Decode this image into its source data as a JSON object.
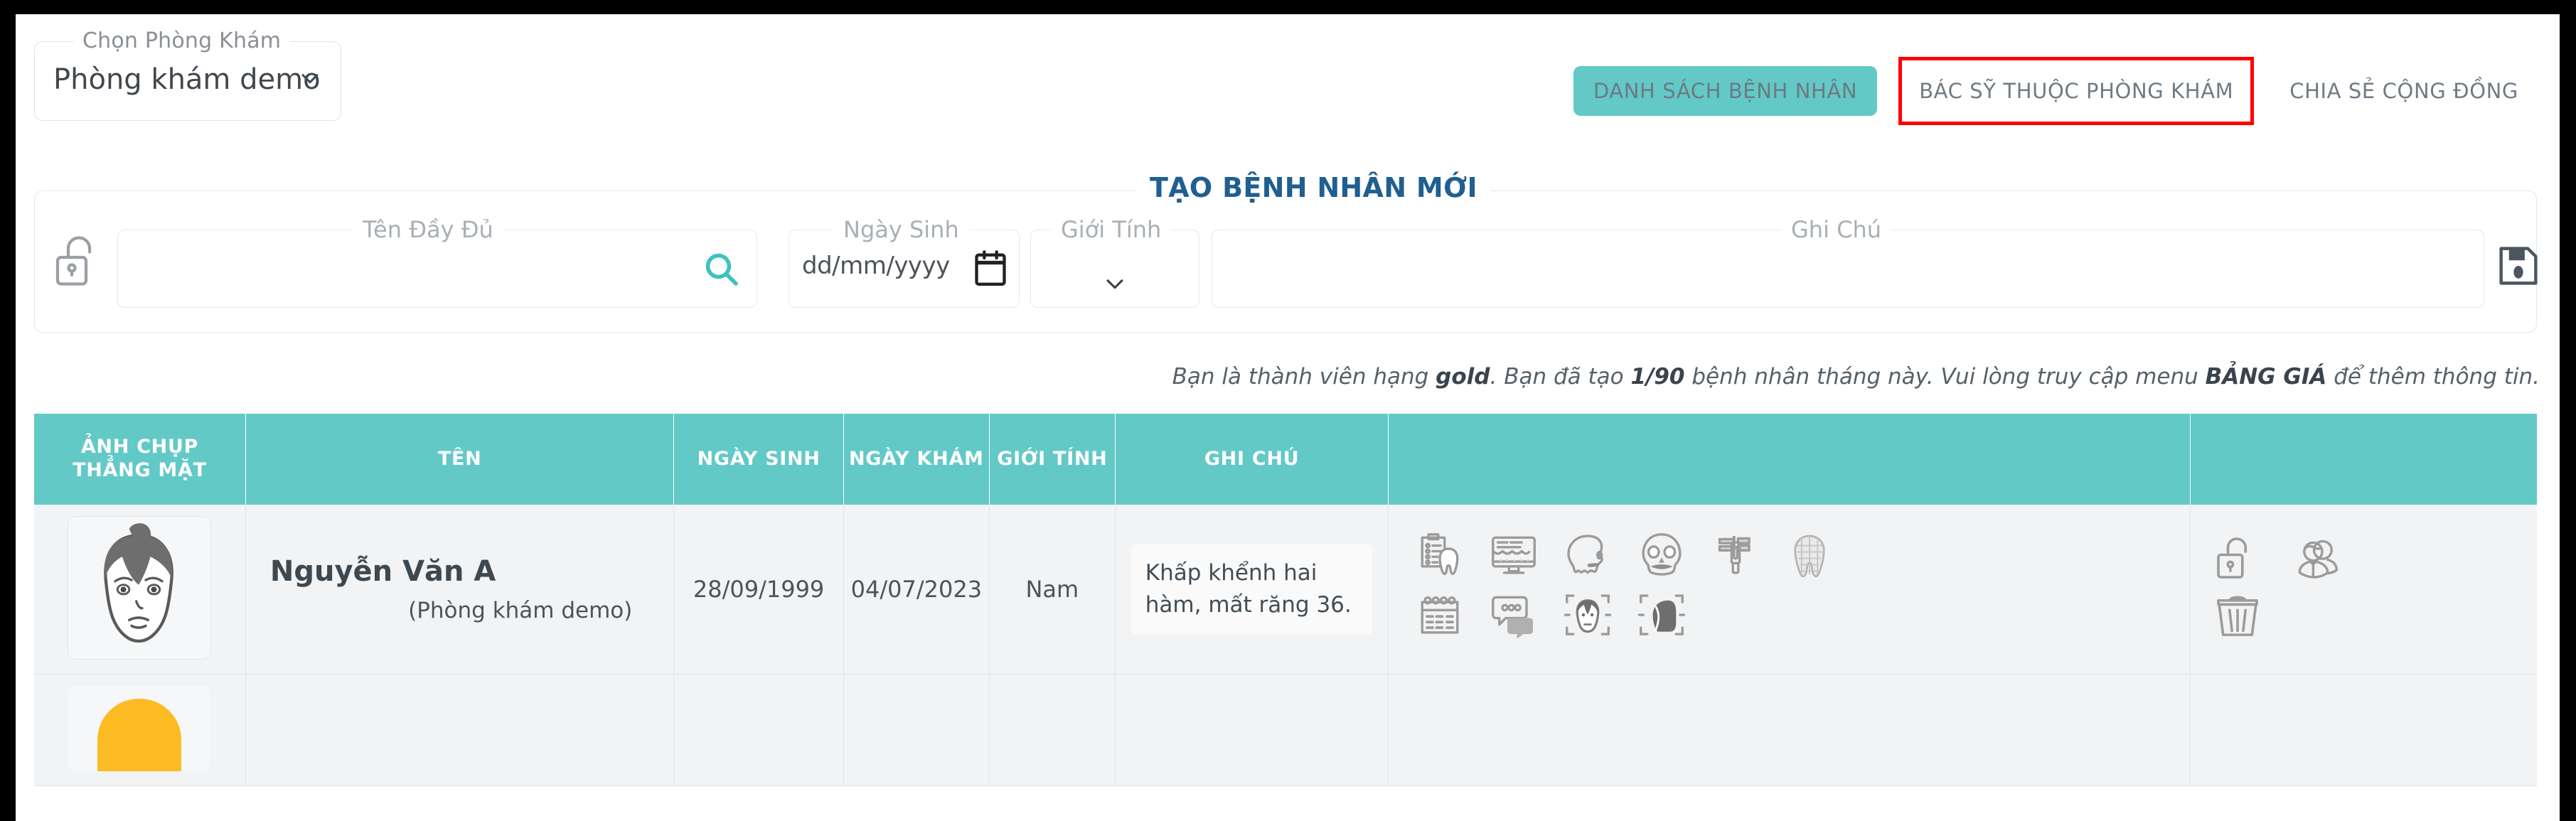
{
  "clinic_selector": {
    "legend": "Chọn Phòng Khám",
    "value": "Phòng khám demo",
    "chevron_icon": "chevron-down-icon"
  },
  "nav": {
    "patient_list": "DANH SÁCH BỆNH NHÂN",
    "clinic_doctors": "BÁC SỸ THUỘC PHÒNG KHÁM",
    "community_share": "CHIA SẺ CỘNG ĐỒNG",
    "highlight_color": "#ff0000",
    "accent_color": "#62c9c7"
  },
  "create_patient": {
    "title": "TẠO BỆNH NHÂN MỚI",
    "lock_icon": "unlock-icon",
    "fields": {
      "full_name": {
        "label": "Tên Đầy Đủ",
        "value": "",
        "placeholder": "",
        "icon": "search-icon"
      },
      "dob": {
        "label": "Ngày Sinh",
        "value": "",
        "placeholder": "dd/mm/yyyy",
        "icon": "calendar-icon"
      },
      "gender": {
        "label": "Giới Tính",
        "value": "",
        "icon": "chevron-down-icon"
      },
      "note": {
        "label": "Ghi Chú",
        "value": "",
        "placeholder": ""
      }
    },
    "save_icon": "save-icon"
  },
  "membership_note": {
    "part1": "Bạn là thành viên hạng ",
    "tier": "gold",
    "part2": ". Bạn đã tạo ",
    "count": "1/90",
    "part3": " bệnh nhân tháng này.  Vui lòng truy cập menu ",
    "menu": "BẢNG GIÁ",
    "part4": " để thêm thông tin."
  },
  "table": {
    "headers": [
      "ẢNH CHỤP THẲNG MẶT",
      "TÊN",
      "NGÀY SINH",
      "NGÀY KHÁM",
      "GIỚI TÍNH",
      "GHI CHÚ",
      "",
      ""
    ],
    "rows": [
      {
        "photo_icon": "patient-face-avatar",
        "name": "Nguyễn Văn A",
        "clinic": "(Phòng khám demo)",
        "dob": "28/09/1999",
        "exam_date": "04/07/2023",
        "gender": "Nam",
        "note": "Khấp khểnh hai hàm, mất răng 36.",
        "tool_icons_row1": [
          "dental-chart-clipboard-icon",
          "monitor-teeth-icon",
          "skull-profile-icon",
          "skull-front-icon",
          "caliper-icon",
          "tooth-3d-icon"
        ],
        "tool_icons_row2": [
          "calendar-icon",
          "chat-bubbles-icon",
          "face-scan-front-icon",
          "face-scan-profile-icon"
        ],
        "action_icons": [
          "unlock-icon",
          "users-icon",
          "trash-icon"
        ]
      },
      {
        "photo_icon": "patient-face-avatar-2"
      }
    ]
  }
}
